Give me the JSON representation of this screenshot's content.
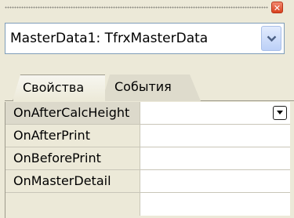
{
  "inspector": {
    "object_selector": {
      "value": "MasterData1: TfrxMasterData"
    },
    "tabs": [
      {
        "label": "Свойства",
        "active": false
      },
      {
        "label": "События",
        "active": true
      }
    ],
    "events": [
      {
        "name": "OnAfterCalcHeight",
        "value": "",
        "selected": true
      },
      {
        "name": "OnAfterPrint",
        "value": ""
      },
      {
        "name": "OnBeforePrint",
        "value": ""
      },
      {
        "name": "OnMasterDetail",
        "value": ""
      },
      {
        "name": "",
        "value": ""
      }
    ]
  },
  "colors": {
    "panel_bg": "#ece9d8",
    "close_button": "#d9411f",
    "combo_border": "#7f9db9"
  },
  "icons": {
    "close": "close-icon",
    "combo_arrow": "chevron-down-icon",
    "row_dropdown": "dropdown-arrow-icon"
  }
}
